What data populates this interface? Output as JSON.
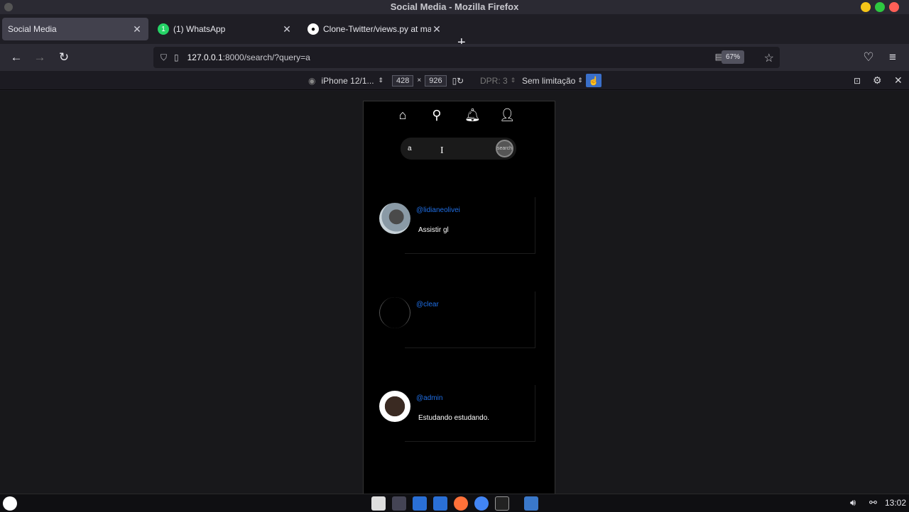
{
  "window": {
    "title": "Social Media - Mozilla Firefox"
  },
  "tabs": [
    {
      "label": "Social Media",
      "active": true
    },
    {
      "label": "(1) WhatsApp",
      "badge": "1",
      "active": false
    },
    {
      "label": "Clone-Twitter/views.py at maste",
      "active": false
    }
  ],
  "urlbar": {
    "host": "127.0.0.1",
    "rest": ":8000/search/?query=a",
    "zoom": "67%"
  },
  "rdm": {
    "device": "iPhone 12/1...",
    "width": "428",
    "times": "×",
    "height": "926",
    "dpr": "DPR: 3",
    "throttle": "Sem limitação"
  },
  "app": {
    "search": {
      "value": "a",
      "button": "search"
    },
    "posts": [
      {
        "user": "@lidianeolivei",
        "text": "Assistir gl"
      },
      {
        "user": "@clear",
        "text": ""
      },
      {
        "user": "@admin",
        "text": "Estudando estudando."
      }
    ]
  },
  "taskbar": {
    "clock": "13:02"
  },
  "colors": {
    "accent_link": "#1f6fe6",
    "whatsapp": "#25d366",
    "close": "#ff5f57"
  }
}
